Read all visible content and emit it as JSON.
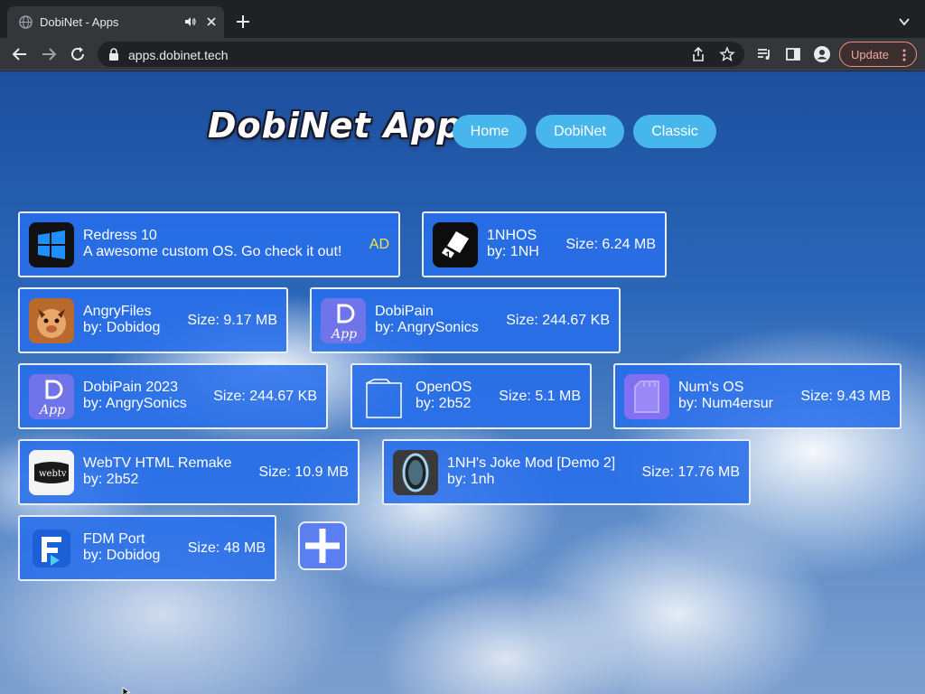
{
  "browser": {
    "tab_title": "DobiNet - Apps",
    "url": "apps.dobinet.tech",
    "update_label": "Update",
    "icons": [
      "globe-icon",
      "speaker-icon",
      "close-icon",
      "plus-icon",
      "chevron-down-icon",
      "back-icon",
      "forward-icon",
      "reload-icon",
      "lock-icon",
      "share-icon",
      "star-icon",
      "media-icon",
      "sidebar-icon",
      "profile-icon",
      "menu-dots-icon"
    ]
  },
  "header": {
    "logo": "DobiNet Apps",
    "nav": [
      "Home",
      "DobiNet",
      "Classic"
    ]
  },
  "apps": [
    {
      "name": "Redress 10",
      "sub": "A awesome custom OS. Go check it out!",
      "badge": "AD",
      "icon": "windows-logo-icon"
    },
    {
      "name": "1NHOS",
      "sub": "by: 1NH",
      "size": "Size: 6.24 MB",
      "icon": "1nhos-icon"
    },
    {
      "name": "AngryFiles",
      "sub": "by: Dobidog",
      "size": "Size: 9.17 MB",
      "icon": "angryfiles-icon"
    },
    {
      "name": "DobiPain",
      "sub": "by: AngrySonics",
      "size": "Size: 244.67 KB",
      "icon": "dobipain-icon"
    },
    {
      "name": "DobiPain 2023",
      "sub": "by: AngrySonics",
      "size": "Size: 244.67 KB",
      "icon": "dobipain-icon"
    },
    {
      "name": "OpenOS",
      "sub": "by: 2b52",
      "size": "Size: 5.1 MB",
      "icon": "openos-icon"
    },
    {
      "name": "Num's OS",
      "sub": "by: Num4ersur",
      "size": "Size: 9.43 MB",
      "icon": "numsos-icon"
    },
    {
      "name": "WebTV HTML Remake",
      "sub": "by: 2b52",
      "size": "Size: 10.9 MB",
      "icon": "webtv-icon"
    },
    {
      "name": "1NH's Joke Mod [Demo 2]",
      "sub": "by: 1nh",
      "size": "Size: 17.76 MB",
      "icon": "portal-icon"
    },
    {
      "name": "FDM Port",
      "sub": "by: Dobidog",
      "size": "Size: 48 MB",
      "icon": "fdm-icon"
    }
  ],
  "add_button": "plus-icon",
  "colors": {
    "card_bg": "#2a6eea",
    "nav_bg": "#46b6ec",
    "ad": "#f2e24a",
    "update": "#f28b82"
  }
}
